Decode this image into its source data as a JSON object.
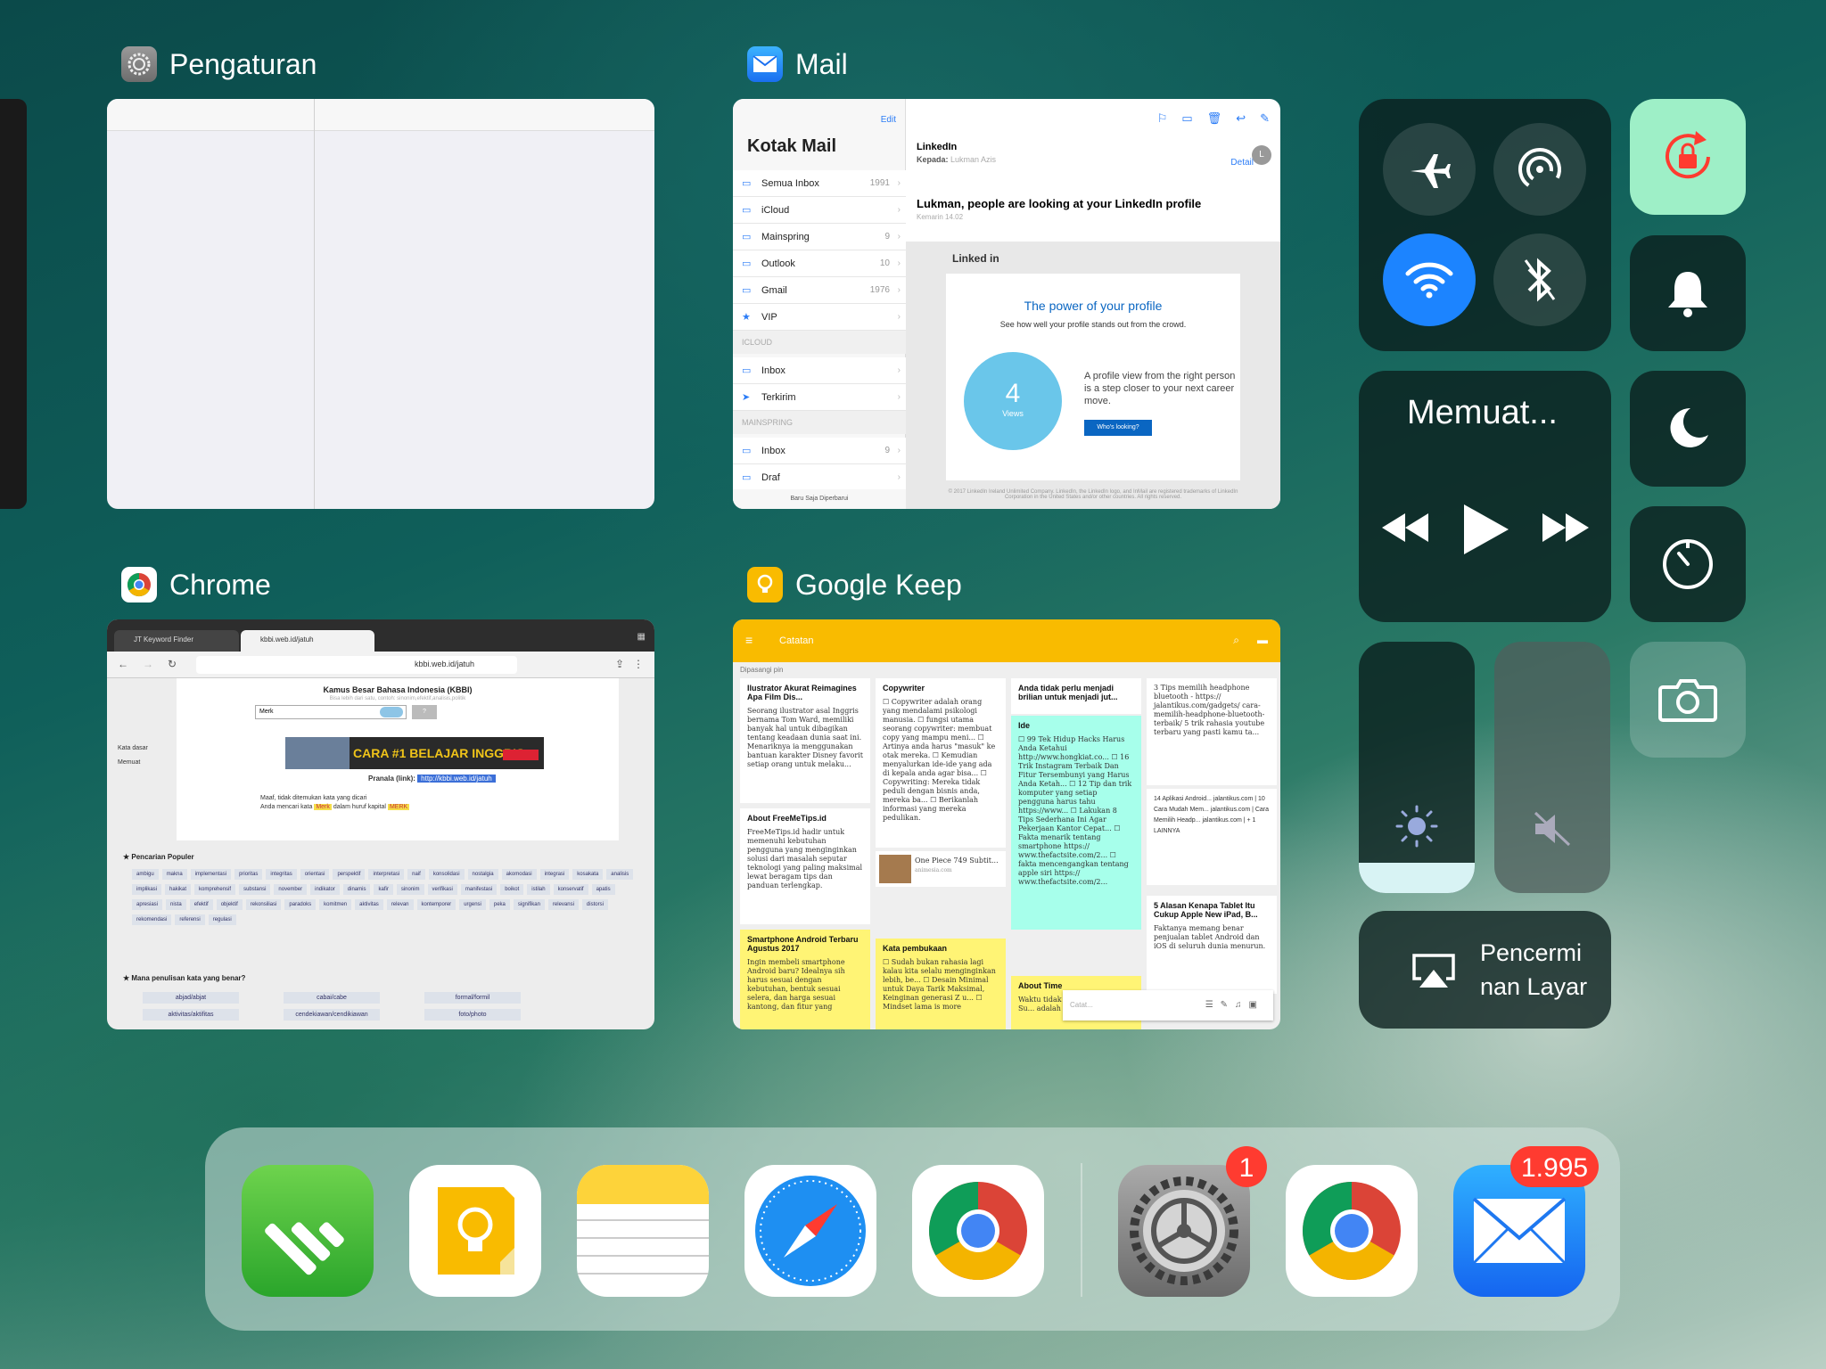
{
  "app_switcher": {
    "settings": {
      "label": "Pengaturan"
    },
    "mail": {
      "label": "Mail",
      "edit": "Edit",
      "mailboxes_title": "Kotak Mail",
      "mailboxes": [
        {
          "label": "Semua Inbox",
          "count": "1991"
        },
        {
          "label": "iCloud",
          "count": ""
        },
        {
          "label": "Mainspring",
          "count": "9"
        },
        {
          "label": "Outlook",
          "count": "10"
        },
        {
          "label": "Gmail",
          "count": "1976"
        },
        {
          "label": "VIP",
          "count": ""
        }
      ],
      "section_icloud": "ICLOUD",
      "icloud_items": [
        {
          "label": "Inbox",
          "count": ""
        },
        {
          "label": "Terkirim",
          "count": ""
        }
      ],
      "section_mainspring": "MAINSPRING",
      "mainspring_items": [
        {
          "label": "Inbox",
          "count": "9"
        },
        {
          "label": "Draf",
          "count": ""
        }
      ],
      "footer": "Baru Saja Diperbarui",
      "message": {
        "from": "LinkedIn",
        "to_label": "Kepada:",
        "to": "Lukman Azis",
        "detail": "Detail",
        "avatar": "L",
        "subject": "Lukman, people are looking at your LinkedIn profile",
        "date": "Kemarin 14.02",
        "brand": "Linked in",
        "headline": "The power of your profile",
        "subheadline": "See how well your profile stands out from the crowd.",
        "views_count": "4",
        "views_label": "Views",
        "body_text": "A profile view from the right person is a step closer to your next career move.",
        "button": "Who's looking?",
        "legal": "© 2017 LinkedIn Ireland Unlimited Company. LinkedIn, the LinkedIn logo, and InMail are registered trademarks of LinkedIn Corporation in the United States and/or other countries. All rights reserved."
      }
    },
    "chrome": {
      "label": "Chrome",
      "tabs": [
        "JT Keyword Finder",
        "kbbi.web.id/jatuh"
      ],
      "url": "kbbi.web.id/jatuh",
      "page_title": "Kamus Besar Bahasa Indonesia (KBBI)",
      "page_subtitle": "Bisa lebih dari satu, contoh: sinonim,efektif,analisis,politik",
      "search_value": "Merk",
      "search_button": "?",
      "side_items": [
        "Kata dasar",
        "Memuat"
      ],
      "banner": "CARA #1 BELAJAR INGGRIS",
      "pranala_label": "Pranala (link):",
      "pranala_link": "http://kbbi.web.id/jatuh",
      "msg_line1": "Maaf, tidak ditemukan kata yang dicari",
      "msg_line2_a": "Anda mencari kata",
      "msg_line2_word": "Merk",
      "msg_line2_b": "dalam huruf kapital",
      "msg_line2_word2": "MERK",
      "popular_title": "★ Pencarian Populer",
      "popular_tags": [
        "ambigu",
        "makna",
        "implementasi",
        "prioritas",
        "integritas",
        "orientasi",
        "perspektif",
        "interpretasi",
        "naif",
        "konsolidasi",
        "nostalgia",
        "akomodasi",
        "integrasi",
        "kosakata",
        "analisis",
        "implikasi",
        "hakikat",
        "komprehensif",
        "substansi",
        "november",
        "indikator",
        "dinamis",
        "kafir",
        "sinonim",
        "verifikasi",
        "manifestasi",
        "boikot",
        "istilah",
        "konservatif",
        "apatis",
        "apresiasi",
        "nista",
        "efektif",
        "objektif",
        "rekonsiliasi",
        "paradoks",
        "komitmen",
        "aktivitas",
        "relevan",
        "kontemporer",
        "urgensi",
        "peka",
        "signifikan",
        "relevansi",
        "distorsi",
        "rekomendasi",
        "referensi",
        "regulasi"
      ],
      "mana_title": "★ Mana penulisan kata yang benar?",
      "mana_items": [
        "abjad/abjat",
        "cabai/cabe",
        "formal/formil",
        "aktivitas/aktifitas",
        "cendekiawan/cendikiawan",
        "foto/photo"
      ]
    },
    "keep": {
      "label": "Google Keep",
      "bar_title": "Catatan",
      "pinned": "Dipasangi pin",
      "input_placeholder": "Catat...",
      "notes": [
        {
          "title": "Ilustrator Akurat Reimagines Apa Film Dis...",
          "body": "Seorang ilustrator asal Inggris bernama Tom Ward, memiliki banyak hal untuk dibagikan tentang keadaan dunia saat ini. Menariknya ia menggunakan bantuan karakter Disney favorit setiap orang untuk melaku..."
        },
        {
          "title": "About FreeMeTips.id",
          "body": "FreeMeTips.id hadir untuk memenuhi kebutuhan pengguna yang menginginkan solusi dari masalah seputar teknologi yang paling maksimal lewat beragam tips dan panduan terlengkap."
        },
        {
          "title": "Smartphone Android Terbaru Agustus 2017",
          "body": "Ingin membeli smartphone Android baru? Idealnya sih harus sesuai dengan kebutuhan, bentuk sesuai selera, dan harga sesuai kantong, dan fitur yang"
        },
        {
          "title": "Copywriter",
          "body": "☐ Copywriter adalah orang yang mendalami psikologi manusia. ☐ fungsi utama seorang copywriter: membuat copy yang mampu meni... ☐ Artinya anda harus \"masuk\" ke otak mereka. ☐ Kemudian menyalurkan ide-ide yang ada di kepala anda agar bisa... ☐ Copywriting: Mereka tidak peduli dengan bisnis anda, mereka ba... ☐ Berikanlah informasi yang mereka pedulikan."
        },
        {
          "title": "One Piece 749 Subtit...",
          "body": "animesia.com"
        },
        {
          "title": "Kata pembukaan",
          "body": "☐ Sudah bukan rahasia lagi kalau kita selalu menginginkan lebih, be... ☐ Desain Minimal untuk Daya Tarik Maksimal, Keinginan generasi Z u... ☐ Mindset lama is more"
        },
        {
          "title": "Anda tidak perlu menjadi brilian untuk menjadi jut...",
          "body": ""
        },
        {
          "title": "Ide",
          "body": "☐ 99 Tek Hidup Hacks Harus Anda Ketahui http://www.hongkiat.co... ☐ 16 Trik Instagram Terbaik Dan Fitur Tersembunyi yang Harus Anda Ketah... ☐ 12 Tip dan trik komputer yang setiap pengguna harus tahu https://www... ☐ Lakukan 8 Tips Sederhana Ini Agar Pekerjaan Kantor Cepat... ☐ Fakta menarik tentang smartphone https:// www.thefactsite.com/2... ☐ fakta mencengangkan tentang apple siri https:// www.thefactsite.com/2..."
        },
        {
          "title": "About Time",
          "body": "Waktu tidak pernah berhenti. Su... adalah orang-orang yang"
        },
        {
          "title": "",
          "body": "3 Tips memilih headphone bluetooth - https:// jalantikus.com/gadgets/ cara-memilih-headphone-bluetooth-terbaik/ 5 trik rahasia youtube terbaru yang pasti kamu ta..."
        },
        {
          "title": "",
          "body": "14 Aplikasi Android... jalantikus.com | 10 Cara Mudah Mem... jalantikus.com | Cara Memilih Headp... jalantikus.com | + 1 LAINNYA"
        },
        {
          "title": "5 Alasan Kenapa Tablet Itu Cukup Apple New iPad, B...",
          "body": "Faktanya memang benar penjualan tablet Android dan iOS di seluruh dunia menurun."
        }
      ]
    }
  },
  "control_center": {
    "media_status": "Memuat...",
    "screen_mirroring": "Pencerminan Layar",
    "mirroring_line1": "Pencermi",
    "mirroring_line2": "nan Layar",
    "colors": {
      "wifi_active": "#1c84ff",
      "rotation_lock_active": "#9eefc7",
      "rotation_lock_icon": "#ff3b30"
    }
  },
  "dock": {
    "apps": [
      "Feedly",
      "Google Keep",
      "Notes",
      "Safari",
      "Chrome",
      "Pengaturan",
      "Chrome",
      "Mail"
    ],
    "settings_badge": "1",
    "mail_badge": "1.995"
  }
}
